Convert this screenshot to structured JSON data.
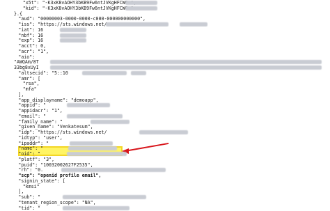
{
  "token": {
    "lines": [
      {
        "indent": 4,
        "text": "\"x5t\": \"-K3xK8vAOHY3bKB9Fw6ntJVKgHFCWGw\","
      },
      {
        "indent": 4,
        "text": "\"kid\": \"-K3xK8vAOHY3bKB9Fw6ntJVKgHFCWGw\""
      },
      {
        "indent": 0,
        "text": "}.{"
      },
      {
        "indent": 2,
        "text": "\"aud\": \"00000003-0000-0000-c000-000000000000\","
      },
      {
        "indent": 2,
        "text": "\"iss\": \"https://sts.windows.net/"
      },
      {
        "indent": 2,
        "text": "\"iat\": 16"
      },
      {
        "indent": 2,
        "text": "\"nbf\": 16"
      },
      {
        "indent": 2,
        "text": "\"exp\": 16"
      },
      {
        "indent": 2,
        "text": "\"acct\": 0,"
      },
      {
        "indent": 2,
        "text": "\"acr\": \"1\","
      },
      {
        "indent": 2,
        "text": "\"aio\":"
      },
      {
        "indent": 0,
        "text": "\"AWQAm/8T"
      },
      {
        "indent": 0,
        "text": "33bg8xUyI"
      },
      {
        "indent": 2,
        "text": "\"altsecid\": \"5::10"
      },
      {
        "indent": 2,
        "text": "\"amr\": ["
      },
      {
        "indent": 4,
        "text": "\"rsa\","
      },
      {
        "indent": 4,
        "text": "\"mfa\""
      },
      {
        "indent": 2,
        "text": "],"
      },
      {
        "indent": 2,
        "text": "\"app_displayname\": \"demoapp\","
      },
      {
        "indent": 2,
        "text": "\"appid\": \""
      },
      {
        "indent": 2,
        "text": "\"appidacr\": \"1\","
      },
      {
        "indent": 2,
        "text": "\"email\": \""
      },
      {
        "indent": 2,
        "text": "\"family_name\": \""
      },
      {
        "indent": 2,
        "text": "\"given_name\": \"Venkatesum\","
      },
      {
        "indent": 2,
        "text": "\"idp\": \"https://sts.windows.net/"
      },
      {
        "indent": 2,
        "text": "\"idtyp\": \"user\","
      },
      {
        "indent": 2,
        "text": "\"ipaddr\": \""
      },
      {
        "indent": 2,
        "text": "\"name\": \""
      },
      {
        "indent": 2,
        "text": "\"oid\": \""
      },
      {
        "indent": 2,
        "text": "\"platf\": \"3\","
      },
      {
        "indent": 2,
        "text": "\"puid\": \"10032002627F2535\","
      },
      {
        "indent": 2,
        "text": "\"rh\": \"0."
      },
      {
        "indent": 2,
        "text": "\"scp\": \"openid profile email\","
      },
      {
        "indent": 2,
        "text": "\"signin_state\": ["
      },
      {
        "indent": 4,
        "text": "\"kmsi\""
      },
      {
        "indent": 2,
        "text": "],"
      },
      {
        "indent": 2,
        "text": "\"sub\": \""
      },
      {
        "indent": 2,
        "text": "\"tenant_region_scope\": \"NA\","
      },
      {
        "indent": 2,
        "text": "\"tid\": \""
      }
    ]
  },
  "annotation": {
    "highlight_color": "#fff34a",
    "highlight_border": "#f2cf00",
    "arrow_color": "#d8141a"
  }
}
